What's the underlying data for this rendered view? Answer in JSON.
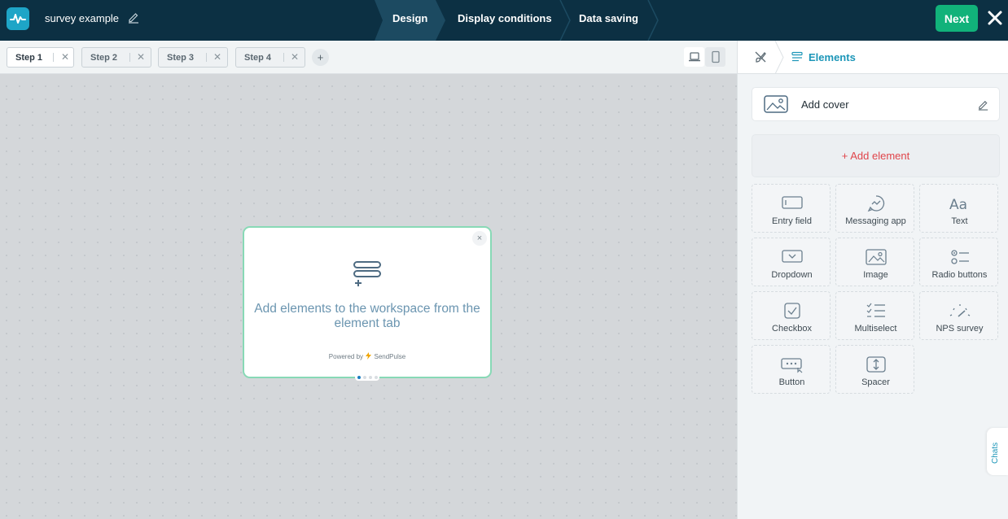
{
  "header": {
    "title": "survey example",
    "nav": [
      "Design",
      "Display conditions",
      "Data saving"
    ],
    "next_label": "Next"
  },
  "tabs": [
    {
      "label": "Step 1",
      "active": true
    },
    {
      "label": "Step 2",
      "active": false
    },
    {
      "label": "Step 3",
      "active": false
    },
    {
      "label": "Step 4",
      "active": false
    }
  ],
  "add_tab_label": "+",
  "card": {
    "message": "Add elements to the workspace from the element tab",
    "powered_prefix": "Powered by",
    "powered_brand": "SendPulse",
    "close_label": "×"
  },
  "panel": {
    "title": "Elements",
    "cover_label": "Add cover",
    "add_element_label": "+ Add element",
    "elements": [
      {
        "label": "Entry field",
        "icon": "entry-field-icon"
      },
      {
        "label": "Messaging app",
        "icon": "messaging-app-icon"
      },
      {
        "label": "Text",
        "icon": "text-icon"
      },
      {
        "label": "Dropdown",
        "icon": "dropdown-icon"
      },
      {
        "label": "Image",
        "icon": "image-icon"
      },
      {
        "label": "Radio buttons",
        "icon": "radio-buttons-icon"
      },
      {
        "label": "Checkbox",
        "icon": "checkbox-icon"
      },
      {
        "label": "Multiselect",
        "icon": "multiselect-icon"
      },
      {
        "label": "NPS survey",
        "icon": "nps-survey-icon"
      },
      {
        "label": "Button",
        "icon": "button-icon"
      },
      {
        "label": "Spacer",
        "icon": "spacer-icon"
      }
    ]
  },
  "chats_label": "Chats",
  "colors": {
    "topbar": "#0c3043",
    "next": "#11b27a",
    "accent": "#1c96b8",
    "add_element": "#e0444a",
    "card_border": "#88d9b6"
  }
}
